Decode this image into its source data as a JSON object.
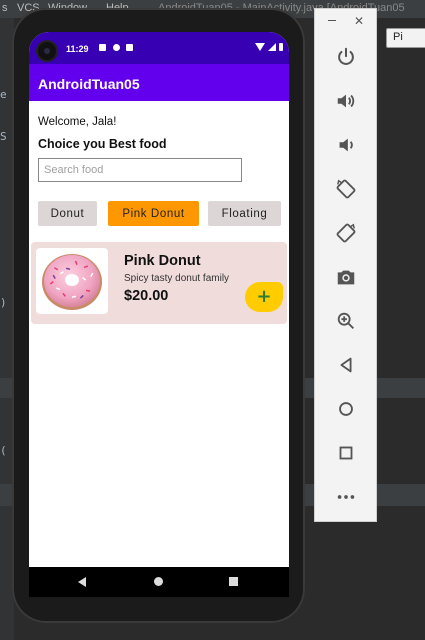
{
  "ide": {
    "menu": [
      "s",
      "VCS",
      "Window",
      "Help"
    ],
    "project_title": "AndroidTuan05 - MainActivity.java [AndroidTuan05",
    "run_config": "Pi"
  },
  "status_bar": {
    "time": "11:29"
  },
  "app_bar": {
    "title": "AndroidTuan05"
  },
  "content": {
    "welcome": "Welcome, Jala!",
    "headline": "Choice you Best food",
    "search_placeholder": "Search food",
    "chips": [
      {
        "label": "Donut",
        "active": false
      },
      {
        "label": "Pink Donut",
        "active": true
      },
      {
        "label": "Floating",
        "active": false
      }
    ],
    "food_card": {
      "name": "Pink Donut",
      "description": "Spicy tasty donut family",
      "price": "$20.00",
      "add_label": "+"
    }
  },
  "colors": {
    "status_bar": "#3700b3",
    "app_bar": "#6200ee",
    "chip_active": "#ff9800",
    "chip_inactive": "#dcd6d6",
    "card_bg": "#f1dcdc",
    "add_button": "#ffcc00"
  },
  "emulator_panel": {
    "buttons": [
      "power-icon",
      "volume-up-icon",
      "volume-down-icon",
      "rotate-left-icon",
      "rotate-right-icon",
      "camera-icon",
      "zoom-icon",
      "back-icon",
      "home-icon",
      "overview-icon",
      "more-icon"
    ]
  }
}
